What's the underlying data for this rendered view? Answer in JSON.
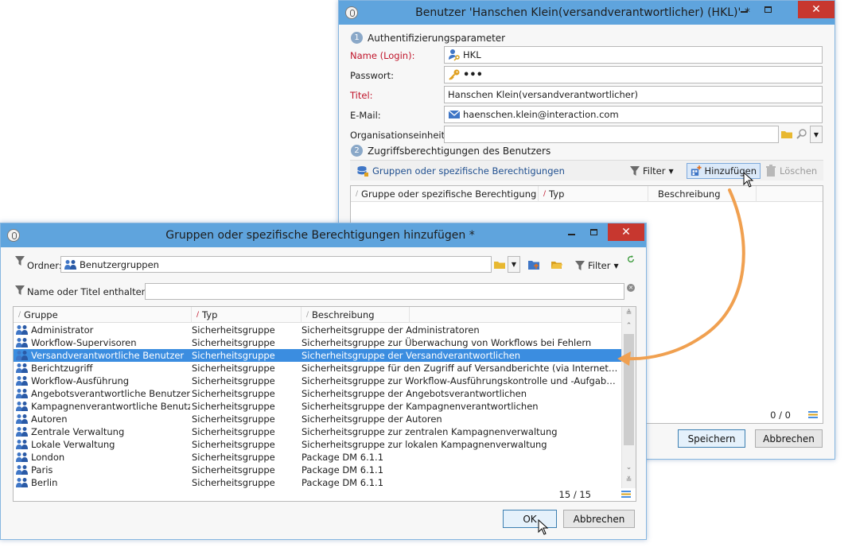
{
  "user_dialog": {
    "title": "Benutzer 'Hanschen Klein(versandverantwortlicher) (HKL)' *",
    "section1": {
      "number": "1",
      "title": "Authentifizierungsparameter"
    },
    "fields": {
      "login_label": "Name (Login):",
      "login_value": "HKL",
      "password_label": "Passwort:",
      "password_value": "•••",
      "title_label": "Titel:",
      "title_value": "Hanschen Klein(versandverantwortlicher)",
      "email_label": "E-Mail:",
      "email_value": "haenschen.klein@interaction.com",
      "org_label": "Organisationseinheit:",
      "org_value": ""
    },
    "section2": {
      "number": "2",
      "title": "Zugriffsberechtigungen des Benutzers"
    },
    "toolbar": {
      "groups_label": "Gruppen oder spezifische Berechtigungen",
      "filter_label": "Filter",
      "add_label": "Hinzufügen",
      "delete_label": "Löschen"
    },
    "grid": {
      "columns": [
        "Gruppe oder spezifische Berechtigung",
        "Typ",
        "Beschreibung"
      ],
      "count": "0 / 0"
    },
    "buttons": {
      "save": "Speichern",
      "cancel": "Abbrechen"
    }
  },
  "add_dialog": {
    "title": "Gruppen oder spezifische Berechtigungen hinzufügen *",
    "folder_label": "Ordner:",
    "folder_value": "Benutzergruppen",
    "filter_label": "Filter",
    "name_filter_label": "Name oder Titel enthalten:",
    "name_filter_value": "",
    "columns": [
      "Gruppe",
      "Typ",
      "Beschreibung"
    ],
    "rows": [
      {
        "group": "Administrator",
        "type": "Sicherheitsgruppe",
        "desc": "Sicherheitsgruppe der Administratoren"
      },
      {
        "group": "Workflow-Supervisoren",
        "type": "Sicherheitsgruppe",
        "desc": "Sicherheitsgruppe zur Überwachung von Workflows bei Fehlern"
      },
      {
        "group": "Versandverantwortliche Benutzer",
        "type": "Sicherheitsgruppe",
        "desc": "Sicherheitsgruppe der Versandverantwortlichen"
      },
      {
        "group": "Berichtzugriff",
        "type": "Sicherheitsgruppe",
        "desc": "Sicherheitsgruppe für den Zugriff auf Versandberichte (via Internetzugang ..."
      },
      {
        "group": "Workflow-Ausführung",
        "type": "Sicherheitsgruppe",
        "desc": "Sicherheitsgruppe zur Workflow-Ausführungskontrolle und -Aufgabenvali..."
      },
      {
        "group": "Angebotsverantwortliche Benutzer",
        "type": "Sicherheitsgruppe",
        "desc": "Sicherheitsgruppe der Angebotsverantwortlichen"
      },
      {
        "group": "Kampagnenverantwortliche Benutzer",
        "type": "Sicherheitsgruppe",
        "desc": "Sicherheitsgruppe der Kampagnenverantwortlichen"
      },
      {
        "group": "Autoren",
        "type": "Sicherheitsgruppe",
        "desc": "Sicherheitsgruppe der Autoren"
      },
      {
        "group": "Zentrale Verwaltung",
        "type": "Sicherheitsgruppe",
        "desc": "Sicherheitsgruppe zur zentralen Kampagnenverwaltung"
      },
      {
        "group": "Lokale Verwaltung",
        "type": "Sicherheitsgruppe",
        "desc": "Sicherheitsgruppe zur lokalen Kampagnenverwaltung"
      },
      {
        "group": "London",
        "type": "Sicherheitsgruppe",
        "desc": "Package DM 6.1.1"
      },
      {
        "group": "Paris",
        "type": "Sicherheitsgruppe",
        "desc": "Package DM 6.1.1"
      },
      {
        "group": "Berlin",
        "type": "Sicherheitsgruppe",
        "desc": "Package DM 6.1.1"
      }
    ],
    "selected_index": 2,
    "count": "15 / 15",
    "buttons": {
      "ok": "OK",
      "cancel": "Abbrechen"
    }
  },
  "colors": {
    "titlebar": "#5fa4dd",
    "close": "#c7372f",
    "selection": "#3b8de0",
    "annotation_arrow": "#f0a050",
    "required_label": "#c0142a"
  }
}
